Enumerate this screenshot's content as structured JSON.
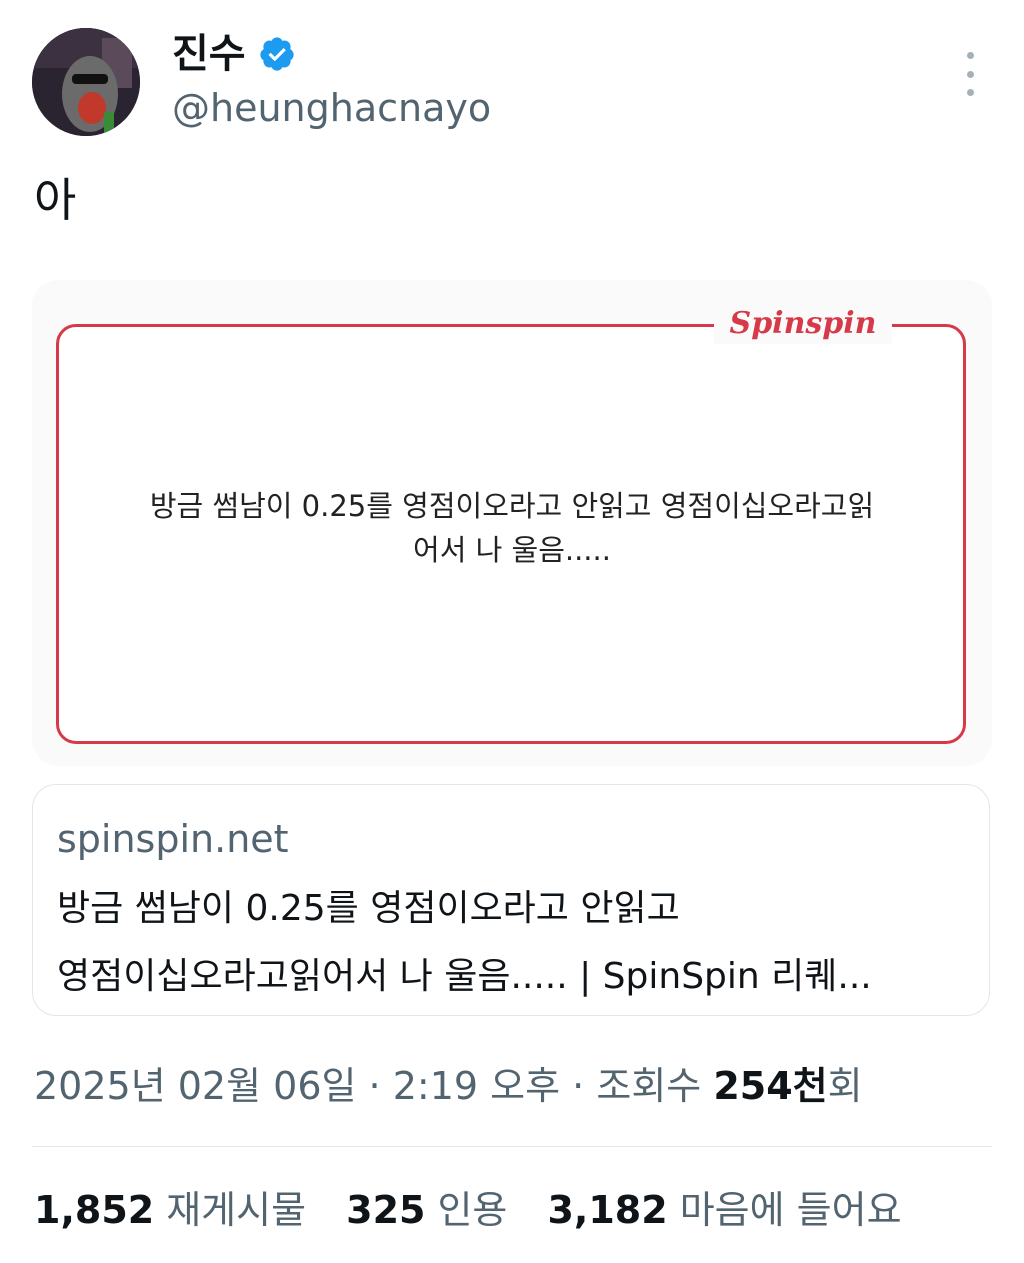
{
  "author": {
    "name": "진수",
    "handle": "@heunghacnayo",
    "verified_icon": "verified-badge-icon",
    "verified_color": "#1d9bf0"
  },
  "tweet": {
    "text": "아"
  },
  "media_card": {
    "brand": "Spinspin",
    "accent_color": "#d63948",
    "line1": "방금 썸남이 0.25를 영점이오라고 안읽고 영점이십오라고읽",
    "line2": "어서 나 울음....."
  },
  "link_preview": {
    "domain": "spinspin.net",
    "title_line1": "방금 썸남이 0.25를 영점이오라고 안읽고",
    "title_line2": "영점이십오라고읽어서 나 울음..... | SpinSpin 리퀘..."
  },
  "meta": {
    "date": "2025년 02월 06일",
    "sep1": "·",
    "time": "2:19 오후",
    "sep2": "·",
    "views_label": "조회수",
    "views_count": "254천",
    "views_suffix": "회"
  },
  "stats": {
    "reposts_count": "1,852",
    "reposts_label": "재게시물",
    "quotes_count": "325",
    "quotes_label": "인용",
    "likes_count": "3,182",
    "likes_label": "마음에 들어요"
  }
}
